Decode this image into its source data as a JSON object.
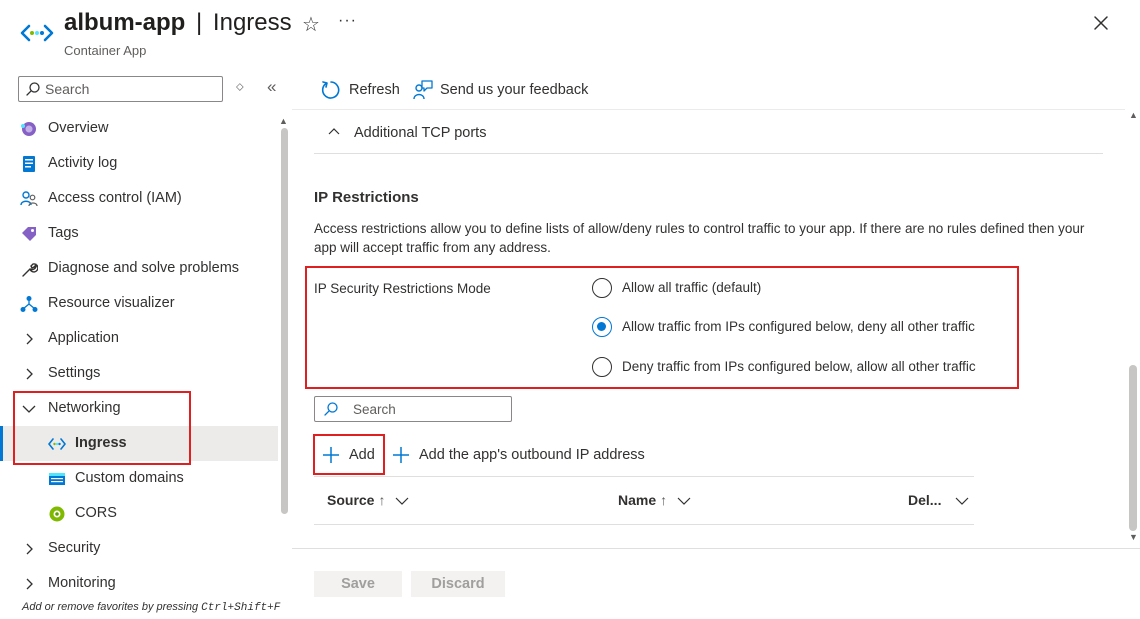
{
  "header": {
    "app_name": "album-app",
    "separator": "|",
    "page_name": "Ingress",
    "subtitle": "Container App"
  },
  "sidebar": {
    "search_placeholder": "Search",
    "items": [
      {
        "label": "Overview",
        "icon": "overview-icon"
      },
      {
        "label": "Activity log",
        "icon": "activity-log-icon"
      },
      {
        "label": "Access control (IAM)",
        "icon": "iam-icon"
      },
      {
        "label": "Tags",
        "icon": "tag-icon"
      },
      {
        "label": "Diagnose and solve problems",
        "icon": "wrench-icon"
      },
      {
        "label": "Resource visualizer",
        "icon": "resource-visualizer-icon"
      },
      {
        "label": "Application",
        "icon": "chevron-right-icon"
      },
      {
        "label": "Settings",
        "icon": "chevron-right-icon"
      },
      {
        "label": "Networking",
        "icon": "chevron-down-icon"
      },
      {
        "label": "Ingress",
        "icon": "ingress-icon"
      },
      {
        "label": "Custom domains",
        "icon": "custom-domains-icon"
      },
      {
        "label": "CORS",
        "icon": "cors-icon"
      },
      {
        "label": "Security",
        "icon": "chevron-right-icon"
      },
      {
        "label": "Monitoring",
        "icon": "chevron-right-icon"
      }
    ],
    "hint_prefix": "Add or remove favorites by pressing ",
    "hint_keys": "Ctrl+Shift+F"
  },
  "toolbar": {
    "refresh_label": "Refresh",
    "feedback_label": "Send us your feedback"
  },
  "main": {
    "tcp_section_label": "Additional TCP ports",
    "ip_heading": "IP Restrictions",
    "ip_description": "Access restrictions allow you to define lists of allow/deny rules to control traffic to your app. If there are no rules defined then your app will accept traffic from any address.",
    "mode_label": "IP Security Restrictions Mode",
    "mode_options": [
      {
        "label": "Allow all traffic (default)",
        "checked": false
      },
      {
        "label": "Allow traffic from IPs configured below, deny all other traffic",
        "checked": true
      },
      {
        "label": "Deny traffic from IPs configured below, allow all other traffic",
        "checked": false
      }
    ],
    "search_placeholder": "Search",
    "add_label": "Add",
    "add_outbound_label": "Add the app's outbound IP address",
    "columns": [
      {
        "label": "Source",
        "sort": "↑"
      },
      {
        "label": "Name",
        "sort": "↑"
      },
      {
        "label": "Del...",
        "sort": ""
      }
    ]
  },
  "footer": {
    "save_label": "Save",
    "discard_label": "Discard"
  },
  "colors": {
    "accent": "#0078d4",
    "highlight_border": "#e02020"
  }
}
